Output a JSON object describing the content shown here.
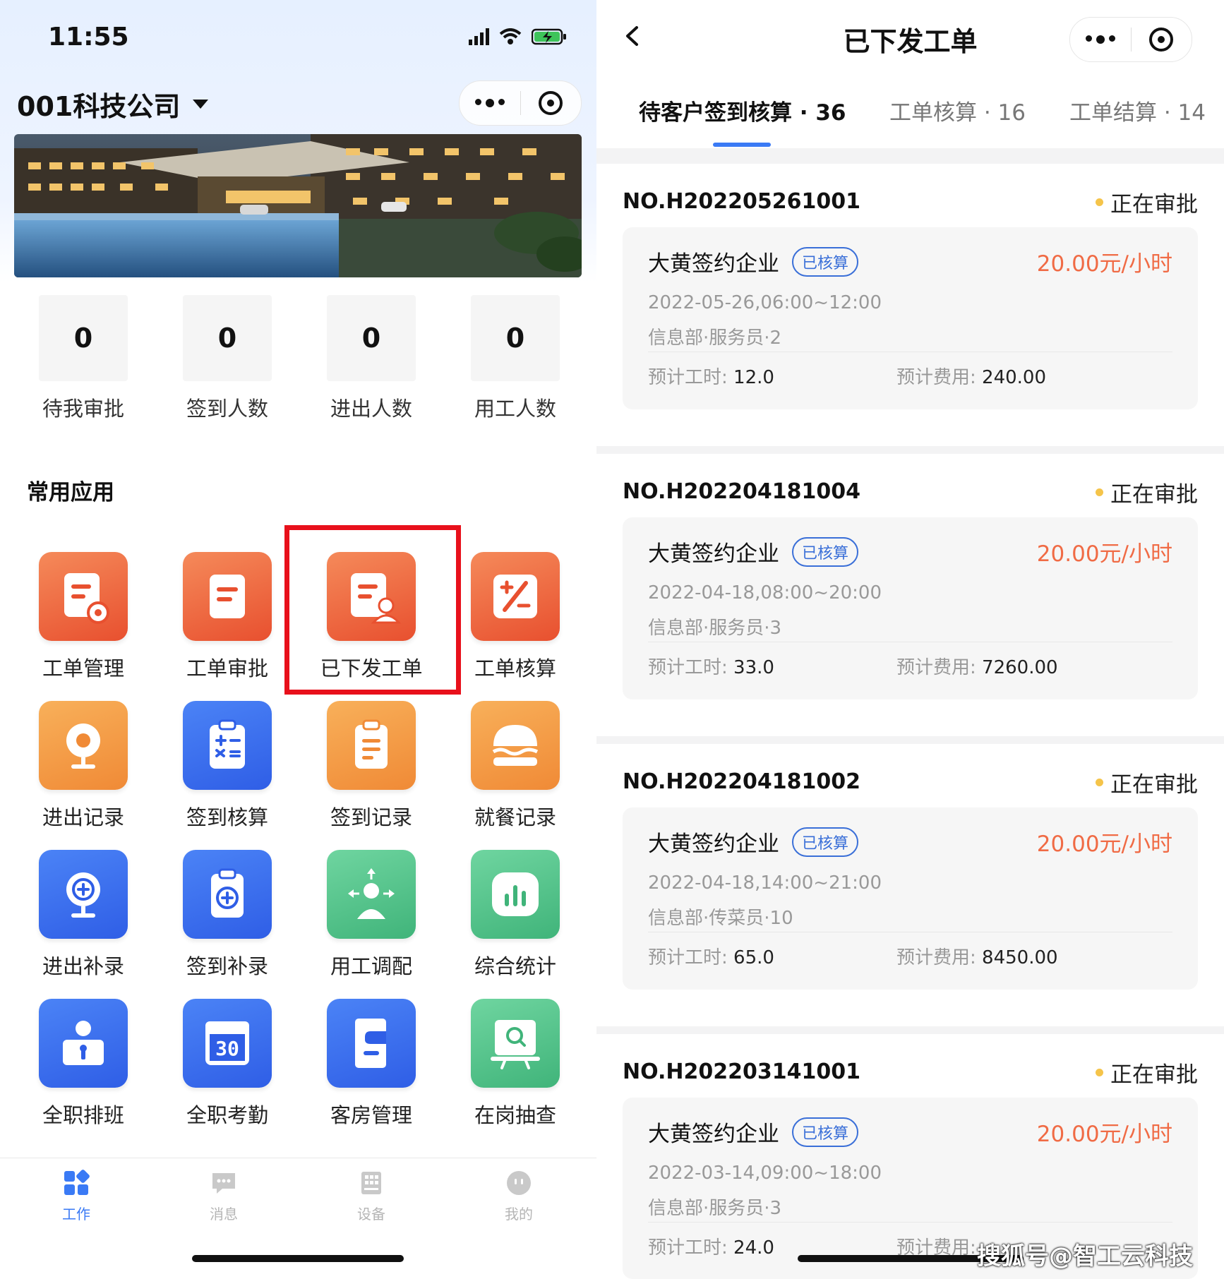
{
  "left": {
    "status": {
      "time": "11:55"
    },
    "header": {
      "company": "001科技公司"
    },
    "stats": [
      {
        "value": "0",
        "label": "待我审批"
      },
      {
        "value": "0",
        "label": "签到人数"
      },
      {
        "value": "0",
        "label": "进出人数"
      },
      {
        "value": "0",
        "label": "用工人数"
      }
    ],
    "section_title": "常用应用",
    "apps": [
      {
        "label": "工单管理",
        "icon": "doc-gear-icon",
        "color": "orange"
      },
      {
        "label": "工单审批",
        "icon": "doc-icon",
        "color": "orange"
      },
      {
        "label": "已下发工单",
        "icon": "doc-user-icon",
        "color": "orange"
      },
      {
        "label": "工单核算",
        "icon": "percent-icon",
        "color": "orange"
      },
      {
        "label": "进出记录",
        "icon": "camera-icon",
        "color": "amber"
      },
      {
        "label": "签到核算",
        "icon": "clipboard-calc-icon",
        "color": "blue"
      },
      {
        "label": "签到记录",
        "icon": "clipboard-icon",
        "color": "amber"
      },
      {
        "label": "就餐记录",
        "icon": "burger-icon",
        "color": "amber"
      },
      {
        "label": "进出补录",
        "icon": "camera-plus-icon",
        "color": "blue"
      },
      {
        "label": "签到补录",
        "icon": "clipboard-plus-icon",
        "color": "blue"
      },
      {
        "label": "用工调配",
        "icon": "person-arrows-icon",
        "color": "green"
      },
      {
        "label": "综合统计",
        "icon": "bar-chart-icon",
        "color": "green"
      },
      {
        "label": "全职排班",
        "icon": "id-card-icon",
        "color": "blue"
      },
      {
        "label": "全职考勤",
        "icon": "calendar-icon",
        "color": "blue"
      },
      {
        "label": "客房管理",
        "icon": "room-icon",
        "color": "blue"
      },
      {
        "label": "在岗抽查",
        "icon": "monitor-search-icon",
        "color": "green"
      }
    ],
    "calendar_day": "30",
    "tabbar": [
      {
        "label": "工作",
        "icon": "grid-icon",
        "active": true
      },
      {
        "label": "消息",
        "icon": "chat-icon",
        "active": false
      },
      {
        "label": "设备",
        "icon": "device-icon",
        "active": false
      },
      {
        "label": "我的",
        "icon": "face-icon",
        "active": false
      }
    ],
    "accent": "#3a7af5",
    "highlight_color": "#e8101b"
  },
  "right": {
    "title": "已下发工单",
    "tabs": [
      {
        "label": "待客户签到核算 · 36",
        "active": true
      },
      {
        "label": "工单核算 · 16",
        "active": false
      },
      {
        "label": "工单结算 · 14",
        "active": false
      }
    ],
    "orders": [
      {
        "no": "NO.H202205261001",
        "status": "正在审批",
        "company": "大黄签约企业",
        "tag": "已核算",
        "price": "20.00元/小时",
        "date": "2022-05-26,06:00~12:00",
        "dept": "信息部·服务员·2",
        "hours_label": "预计工时:",
        "hours": "12.0",
        "fee_label": "预计费用:",
        "fee": "240.00"
      },
      {
        "no": "NO.H202204181004",
        "status": "正在审批",
        "company": "大黄签约企业",
        "tag": "已核算",
        "price": "20.00元/小时",
        "date": "2022-04-18,08:00~20:00",
        "dept": "信息部·服务员·3",
        "hours_label": "预计工时:",
        "hours": "33.0",
        "fee_label": "预计费用:",
        "fee": "7260.00"
      },
      {
        "no": "NO.H202204181002",
        "status": "正在审批",
        "company": "大黄签约企业",
        "tag": "已核算",
        "price": "20.00元/小时",
        "date": "2022-04-18,14:00~21:00",
        "dept": "信息部·传菜员·10",
        "hours_label": "预计工时:",
        "hours": "65.0",
        "fee_label": "预计费用:",
        "fee": "8450.00"
      },
      {
        "no": "NO.H202203141001",
        "status": "正在审批",
        "company": "大黄签约企业",
        "tag": "已核算",
        "price": "20.00元/小时",
        "date": "2022-03-14,09:00~18:00",
        "dept": "信息部·服务员·3",
        "hours_label": "预计工时:",
        "hours": "24.0",
        "fee_label": "预计费用:",
        "fee": ""
      }
    ],
    "watermark": "搜狐号@智工云科技",
    "price_color": "#f06b45",
    "status_dot_color": "#f5c44a"
  }
}
